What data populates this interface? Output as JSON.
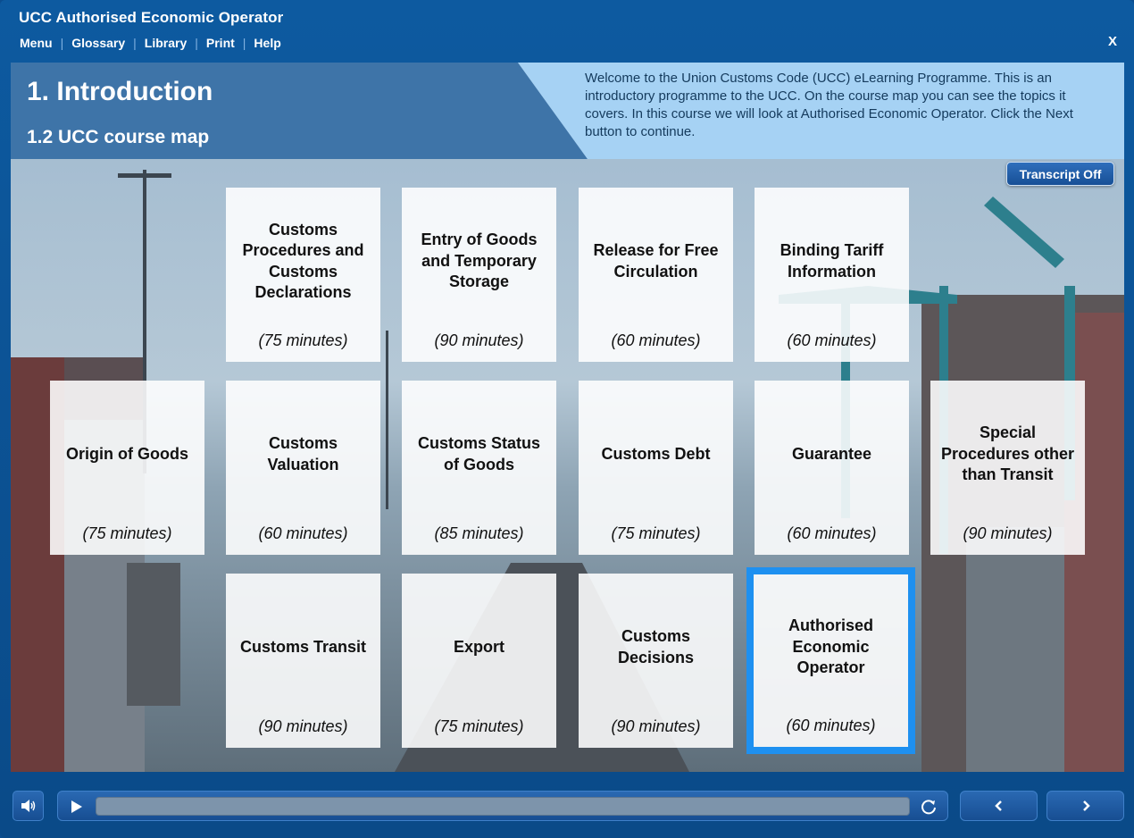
{
  "app": {
    "title": "UCC  Authorised Economic Operator",
    "nav": [
      "Menu",
      "Glossary",
      "Library",
      "Print",
      "Help"
    ],
    "close_label": "X"
  },
  "header": {
    "title": "1. Introduction",
    "subtitle": "1.2 UCC course map",
    "intro_text": "Welcome to the Union Customs Code (UCC) eLearning Programme. This is an introductory programme to the UCC. On the course map you can see the topics it covers. In this course we will look at Authorised Economic Operator. Click the Next button to continue."
  },
  "transcript_button": "Transcript Off",
  "tiles": [
    {
      "title": "Customs Procedures and Customs Declarations",
      "duration": "(75 minutes)"
    },
    {
      "title": "Entry of Goods and Temporary Storage",
      "duration": "(90 minutes)"
    },
    {
      "title": "Release for Free Circulation",
      "duration": "(60 minutes)"
    },
    {
      "title": "Binding Tariff Information",
      "duration": "(60 minutes)"
    },
    {
      "title": "Origin of Goods",
      "duration": "(75 minutes)"
    },
    {
      "title": "Customs Valuation",
      "duration": "(60 minutes)"
    },
    {
      "title": "Customs Status of Goods",
      "duration": "(85 minutes)"
    },
    {
      "title": "Customs Debt",
      "duration": "(75 minutes)"
    },
    {
      "title": "Guarantee",
      "duration": "(60 minutes)"
    },
    {
      "title": "Special Procedures other than Transit",
      "duration": "(90 minutes)"
    },
    {
      "title": "Customs Transit",
      "duration": "(90 minutes)"
    },
    {
      "title": "Export",
      "duration": "(75 minutes)"
    },
    {
      "title": "Customs Decisions",
      "duration": "(90 minutes)"
    },
    {
      "title": "Authorised Economic Operator",
      "duration": "(60 minutes)"
    }
  ],
  "selected_tile": "Authorised Economic Operator",
  "controls": {
    "audio_icon": "speaker-icon",
    "play_icon": "play-icon",
    "replay_icon": "replay-icon",
    "prev_icon": "chevron-left-icon",
    "next_icon": "chevron-right-icon",
    "progress": 0
  },
  "colors": {
    "frame": "#0d5aa0",
    "header_dark": "#3e74a8",
    "header_light": "#a6d2f4",
    "selected_border": "#1e90f0"
  }
}
